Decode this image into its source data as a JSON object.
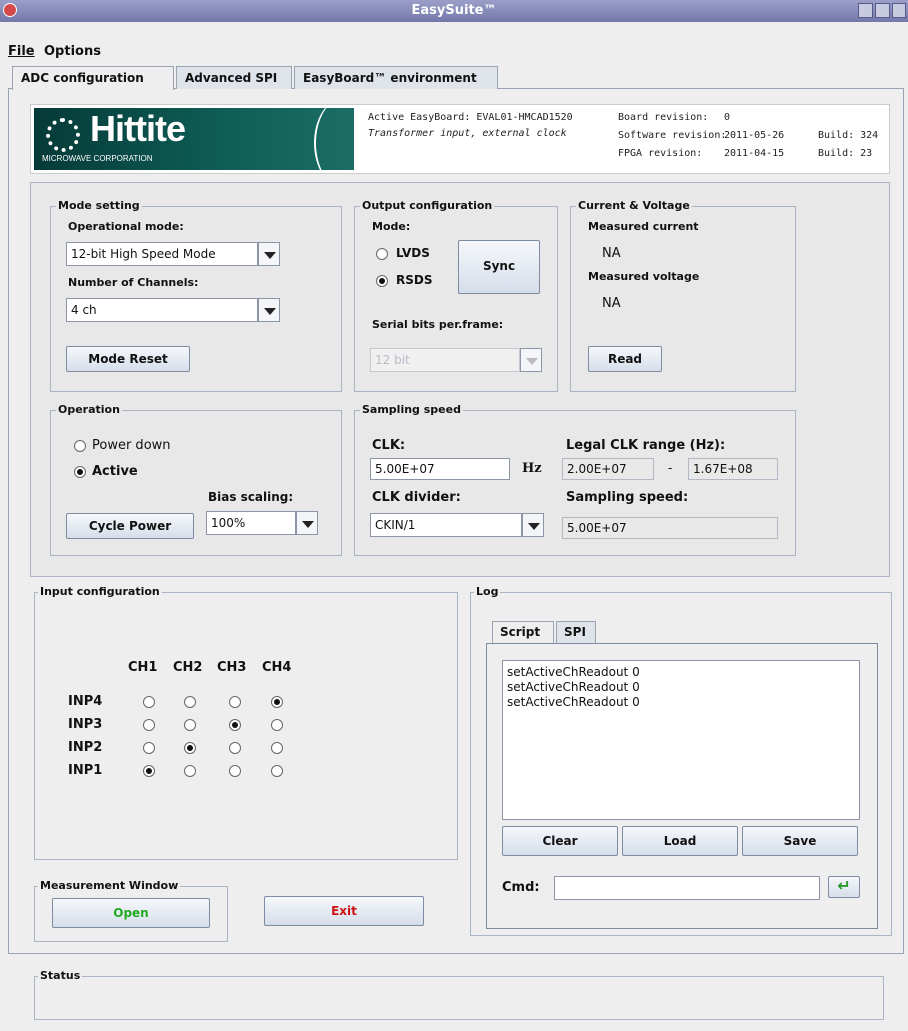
{
  "window": {
    "title": "EasySuite™"
  },
  "menu": [
    "File",
    "Options"
  ],
  "tabs": [
    "ADC configuration",
    "Advanced SPI",
    "EasyBoard™ environment"
  ],
  "header": {
    "logo_brand": "Hittite",
    "logo_corp": "MICROWAVE CORPORATION",
    "active_board": "Active EasyBoard: EVAL01-HMCAD1520",
    "input_desc": "Transformer input, external clock",
    "board_revision_label": "Board revision:",
    "board_revision": "0",
    "software_revision_label": "Software revision:",
    "software_revision": "2011-05-26",
    "software_build": "Build: 324",
    "fpga_revision_label": "FPGA revision:",
    "fpga_revision": "2011-04-15",
    "fpga_build": "Build: 23"
  },
  "mode_setting": {
    "title": "Mode setting",
    "operational_mode_label": "Operational mode:",
    "operational_mode": "12-bit High Speed Mode",
    "channels_label": "Number of Channels:",
    "channels": "4 ch",
    "reset_button": "Mode Reset"
  },
  "output_config": {
    "title": "Output configuration",
    "mode_label": "Mode:",
    "lvds": "LVDS",
    "rsds": "RSDS",
    "sync_button": "Sync",
    "serial_bits_label": "Serial bits per.frame:",
    "serial_bits": "12 bit"
  },
  "current_voltage": {
    "title": "Current & Voltage",
    "current_label": "Measured current",
    "current_value": "NA",
    "voltage_label": "Measured voltage",
    "voltage_value": "NA",
    "read_button": "Read"
  },
  "operation": {
    "title": "Operation",
    "power_down": "Power down",
    "active": "Active",
    "bias_label": "Bias scaling:",
    "bias_value": "100%",
    "cycle_button": "Cycle Power"
  },
  "sampling": {
    "title": "Sampling speed",
    "clk_label": "CLK:",
    "clk_value": "5.00E+07",
    "hz": "Hz",
    "legal_label": "Legal CLK range (Hz):",
    "legal_min": "2.00E+07",
    "dash": "-",
    "legal_max": "1.67E+08",
    "divider_label": "CLK divider:",
    "divider_value": "CKIN/1",
    "speed_label": "Sampling speed:",
    "speed_value": "5.00E+07"
  },
  "input_config": {
    "title": "Input configuration",
    "channels": [
      "CH1",
      "CH2",
      "CH3",
      "CH4"
    ],
    "inputs": [
      "INP4",
      "INP3",
      "INP2",
      "INP1"
    ],
    "selected": [
      4,
      3,
      2,
      1
    ]
  },
  "log": {
    "title": "Log",
    "tabs": [
      "Script",
      "SPI"
    ],
    "lines": [
      "setActiveChReadout 0",
      "setActiveChReadout 0",
      "setActiveChReadout 0"
    ],
    "clear_button": "Clear",
    "load_button": "Load",
    "save_button": "Save",
    "cmd_label": "Cmd:",
    "cmd_value": ""
  },
  "measurement": {
    "title": "Measurement Window",
    "open_button": "Open",
    "exit_button": "Exit"
  },
  "status": {
    "title": "Status",
    "text": ""
  },
  "colors": {
    "open_green": "#22aa22",
    "exit_red": "#cc1111",
    "enter_green": "#2a9a2a"
  }
}
